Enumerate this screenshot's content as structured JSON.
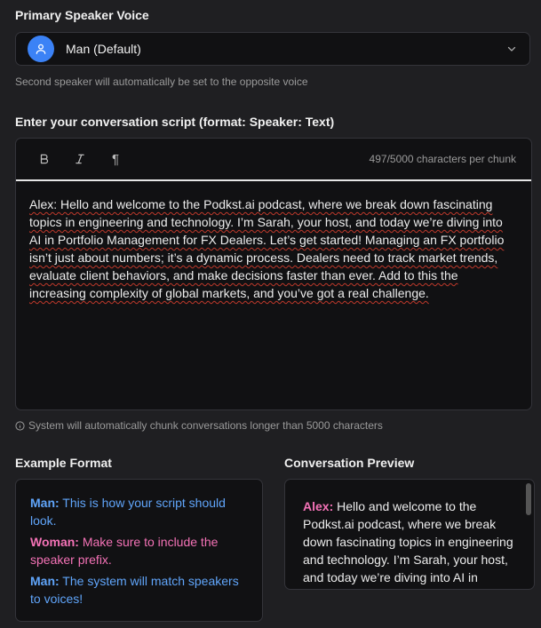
{
  "primary_voice": {
    "label": "Primary Speaker Voice",
    "selected": "Man (Default)",
    "hint": "Second speaker will automatically be set to the opposite voice"
  },
  "script_section": {
    "label": "Enter your conversation script (format: Speaker: Text)",
    "toolbar": {
      "bold": "B",
      "italic": "I",
      "paragraph": "¶",
      "char_count": "497/5000 characters per chunk"
    },
    "text": "Alex: Hello and welcome to the Podkst.ai podcast, where we break down fascinating topics in engineering and technology. I’m Sarah, your host, and today we’re diving into AI in Portfolio Management for FX Dealers. Let’s get started! Managing an FX portfolio isn’t just about numbers; it’s a dynamic process. Dealers need to track market trends, evaluate client behaviors, and make decisions faster than ever. Add to this the increasing complexity of global markets, and you’ve got a real challenge.",
    "chunk_hint": "System will automatically chunk conversations longer than 5000 characters"
  },
  "example_format": {
    "label": "Example Format",
    "lines": [
      {
        "speaker": "Man:",
        "text": " This is how your script should look."
      },
      {
        "speaker": "Woman:",
        "text": " Make sure to include the speaker prefix."
      },
      {
        "speaker": "Man:",
        "text": " The system will match speakers to voices!"
      }
    ]
  },
  "preview": {
    "label": "Conversation Preview",
    "speaker": "Alex:",
    "text": " Hello and welcome to the Podkst.ai podcast, where we break down fascinating topics in engineering and technology. I’m Sarah, your host, and today we’re diving into AI in Portfolio Management for FX Dealers."
  },
  "colors": {
    "accent": "#3b82f6",
    "man": "#60a5fa",
    "woman": "#f472b6",
    "background": "#1f1f22",
    "panel": "#111113"
  }
}
